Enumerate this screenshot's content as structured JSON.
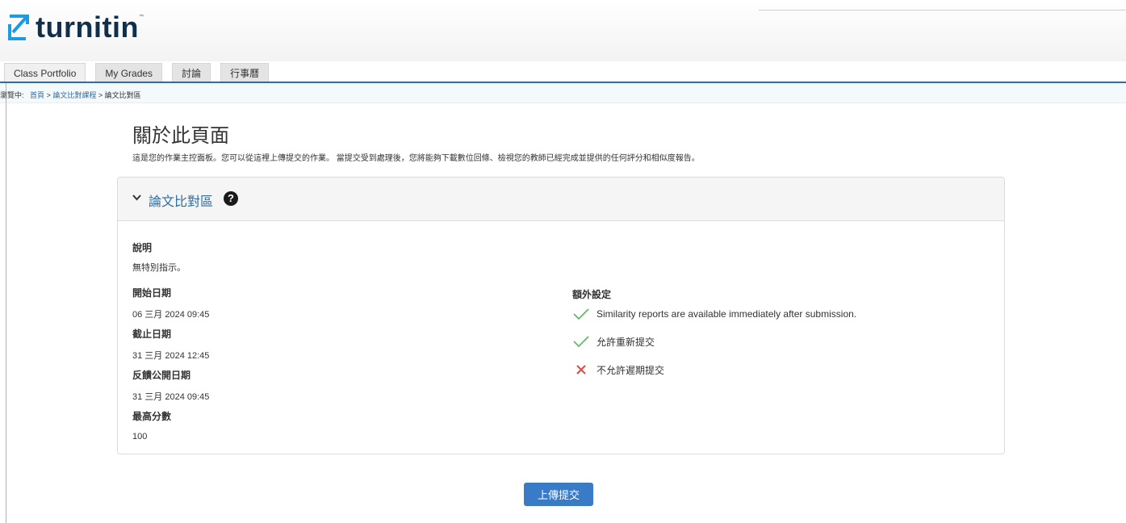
{
  "brand": {
    "name": "turnitin",
    "trademark": "™"
  },
  "tabs": [
    "Class Portfolio",
    "My Grades",
    "討論",
    "行事曆"
  ],
  "breadcrumb": {
    "prefix": "瀏覽中:",
    "items": [
      "首頁",
      "論文比對課程",
      "論文比對區"
    ],
    "separator": ">"
  },
  "page": {
    "title": "關於此頁面",
    "description": "這是您的作業主控面板。您可以從這裡上傳提交的作業。 當提交受到處理後，您將能夠下載數位回條、檢視您的教師已經完成並提供的任何評分和相似度報告。"
  },
  "panel": {
    "title": "論文比對區",
    "help_glyph": "?",
    "instructions_label": "說明",
    "instructions_value": "無特別指示。",
    "start_label": "開始日期",
    "start_value": "06 三月 2024 09:45",
    "due_label": "截止日期",
    "due_value": "31 三月 2024 12:45",
    "feedback_label": "反饋公開日期",
    "feedback_value": "31 三月 2024 09:45",
    "max_label": "最高分數",
    "max_value": "100",
    "settings_label": "額外設定",
    "settings": [
      {
        "text": "Similarity reports are available immediately after submission.",
        "status": "yes"
      },
      {
        "text": "允許重新提交",
        "status": "yes"
      },
      {
        "text": "不允許遲期提交",
        "status": "no"
      }
    ]
  },
  "actions": {
    "upload": "上傳提交"
  },
  "colors": {
    "accent": "#2e6da4",
    "button": "#3a7bc8",
    "check": "#5cb85c",
    "cross": "#d9534f",
    "logo": "#0f2f4d"
  }
}
